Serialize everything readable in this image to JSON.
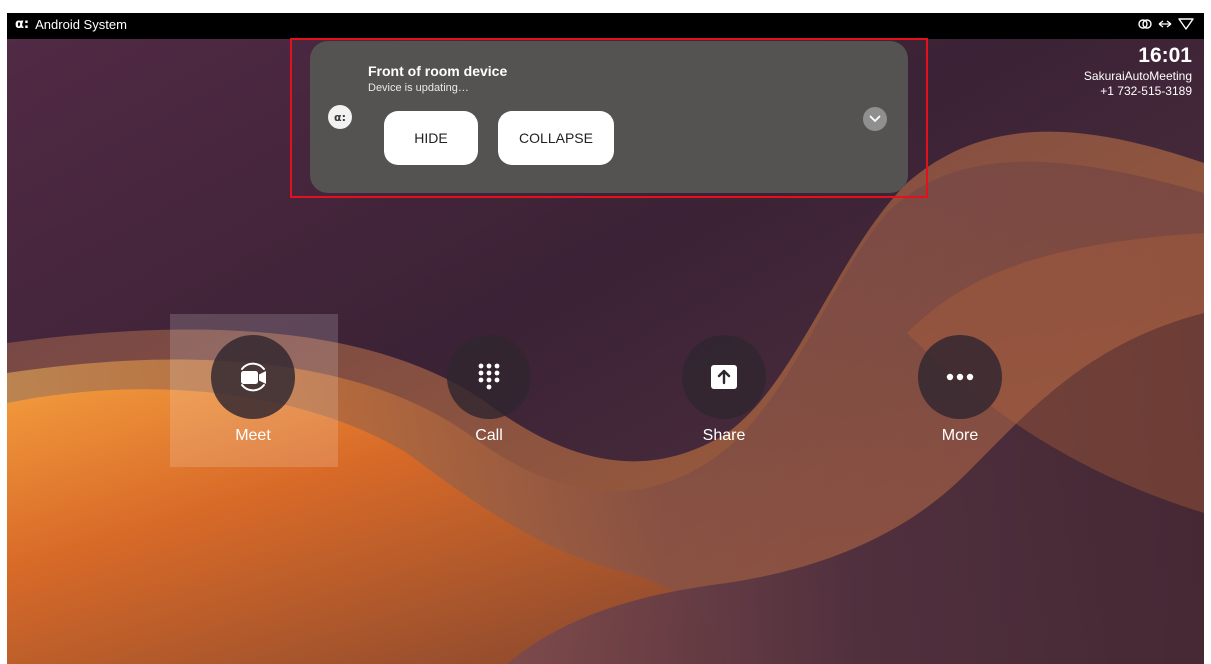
{
  "status_bar": {
    "app_name": "Android System",
    "logo_glyph": "α:",
    "icons": [
      "rings-icon",
      "arrows-icon",
      "wifi-icon"
    ]
  },
  "clock": {
    "time": "16:01",
    "meeting_name": "SakuraiAutoMeeting",
    "meeting_number": "+1 732-515-3189"
  },
  "notification": {
    "app_glyph": "α:",
    "title": "Front of room device",
    "subtitle": "Device is updating…",
    "hide_label": "HIDE",
    "collapse_label": "COLLAPSE",
    "expand_icon": "chevron-down-icon"
  },
  "dock": {
    "meet_label": "Meet",
    "call_label": "Call",
    "share_label": "Share",
    "more_label": "More"
  },
  "colors": {
    "notification_bg": "#545352",
    "highlight": "#e4101c",
    "dock_circle": "#302630"
  }
}
